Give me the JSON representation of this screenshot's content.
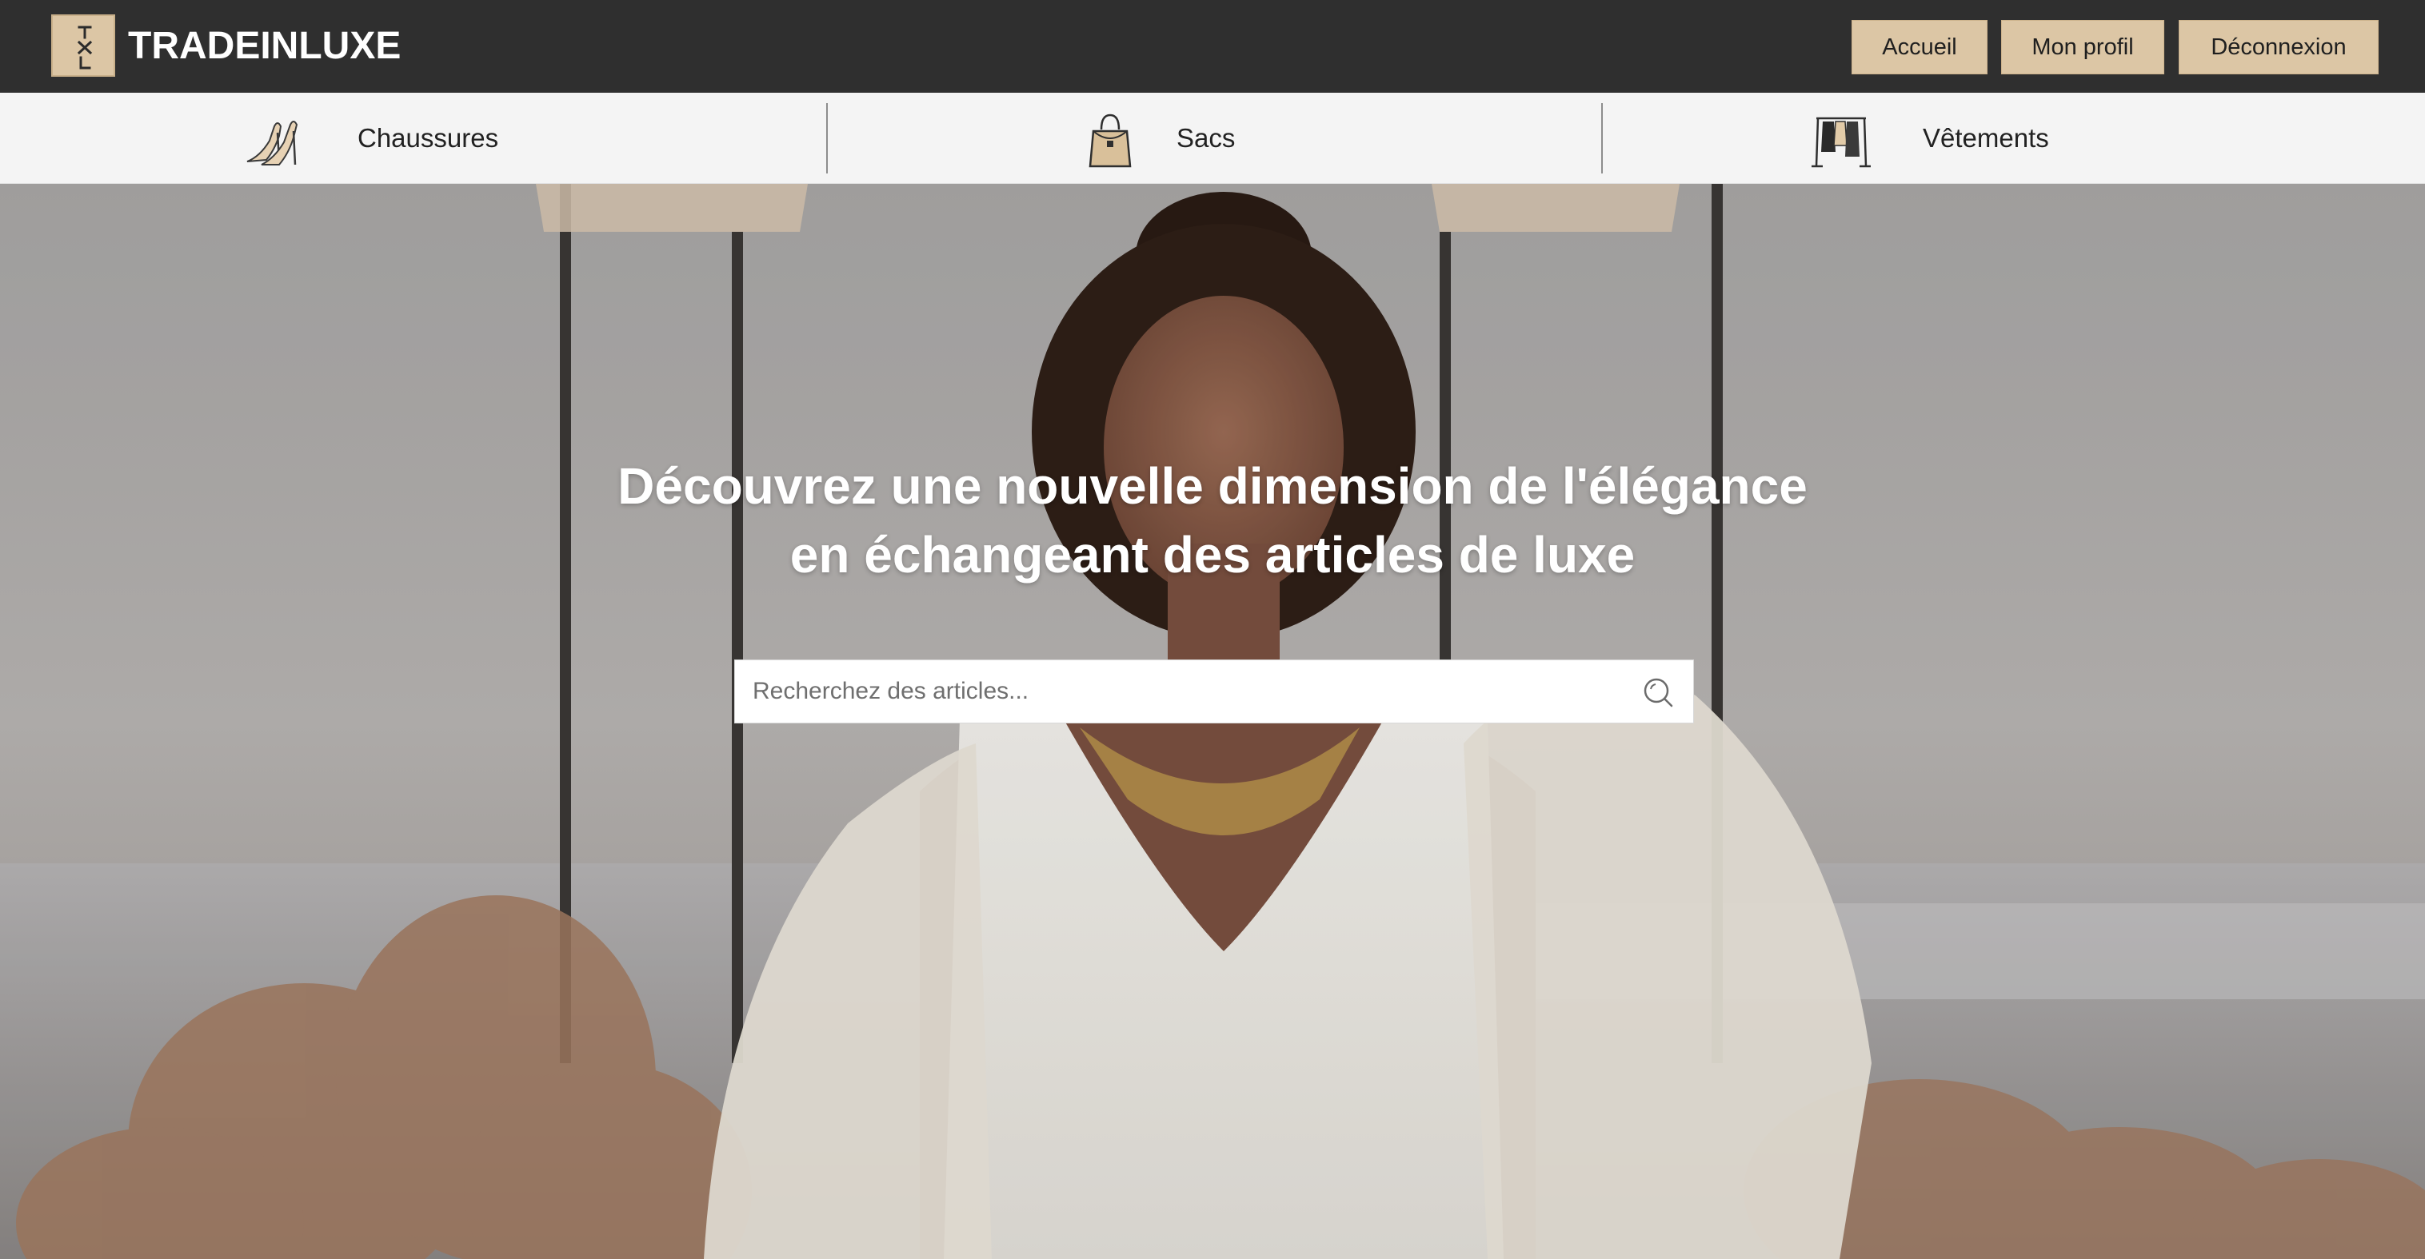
{
  "header": {
    "logo_text": "TXL",
    "brand": "TRADEINLUXE",
    "nav": {
      "home": "Accueil",
      "profile": "Mon profil",
      "logout": "Déconnexion"
    }
  },
  "categories": [
    {
      "label": "Chaussures",
      "icon": "heels-icon"
    },
    {
      "label": "Sacs",
      "icon": "handbag-icon"
    },
    {
      "label": "Vêtements",
      "icon": "clothes-rack-icon"
    }
  ],
  "hero": {
    "title_line1": "Découvrez une nouvelle dimension de l'élégance",
    "title_line2": "en échangeant des articles de luxe"
  },
  "search": {
    "placeholder": "Recherchez des articles...",
    "icon": "search-icon"
  },
  "colors": {
    "topbar": "#2f2f2f",
    "accent": "#dcc6a5",
    "catbar": "#f4f4f4"
  }
}
